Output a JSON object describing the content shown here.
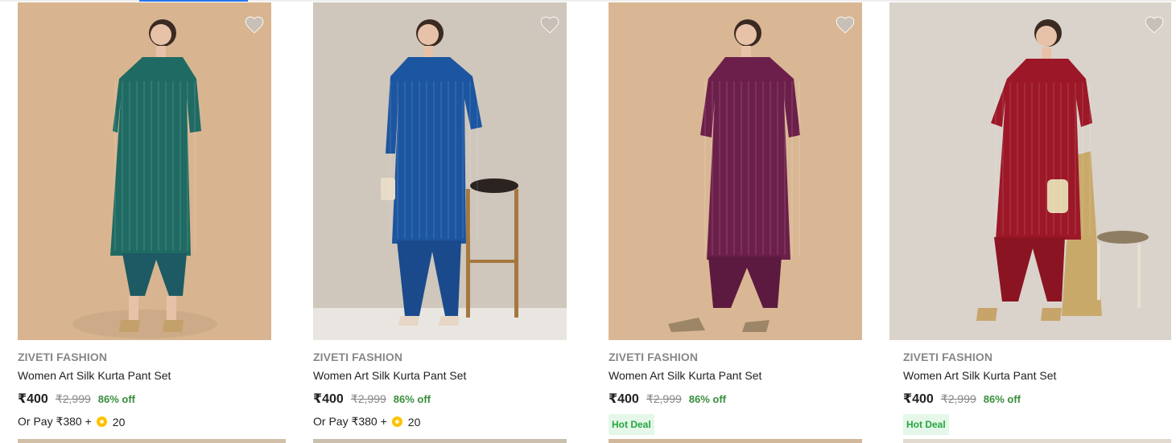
{
  "page": {
    "tab_indicator_color": "#2874f0"
  },
  "products": [
    {
      "brand": "ZIVETI FASHION",
      "title": "Women Art Silk Kurta Pant Set",
      "price": "₹400",
      "mrp": "₹2,999",
      "discount": "86% off",
      "pay_prefix": "Or Pay ₹380 +",
      "coins": "20",
      "hot_deal": null,
      "bg": "#d8b590",
      "kurta_color": "#1f6b63",
      "pant_color": "#1d5a64",
      "image_icon": "model-photo"
    },
    {
      "brand": "ZIVETI FASHION",
      "title": "Women Art Silk Kurta Pant Set",
      "price": "₹400",
      "mrp": "₹2,999",
      "discount": "86% off",
      "pay_prefix": "Or Pay ₹380 +",
      "coins": "20",
      "hot_deal": null,
      "bg": "#cfc6bc",
      "kurta_color": "#1c55a0",
      "pant_color": "#1a4a8c",
      "image_icon": "model-photo"
    },
    {
      "brand": "ZIVETI FASHION",
      "title": "Women Art Silk Kurta Pant Set",
      "price": "₹400",
      "mrp": "₹2,999",
      "discount": "86% off",
      "pay_prefix": null,
      "coins": null,
      "hot_deal": "Hot Deal",
      "bg": "#d9b794",
      "kurta_color": "#6c1f4a",
      "pant_color": "#5c1a40",
      "image_icon": "model-photo"
    },
    {
      "brand": "ZIVETI FASHION",
      "title": "Women Art Silk Kurta Pant Set",
      "price": "₹400",
      "mrp": "₹2,999",
      "discount": "86% off",
      "pay_prefix": null,
      "coins": null,
      "hot_deal": "Hot Deal",
      "bg": "#dad3cb",
      "kurta_color": "#9c1727",
      "pant_color": "#8b1422",
      "image_icon": "model-photo"
    }
  ]
}
